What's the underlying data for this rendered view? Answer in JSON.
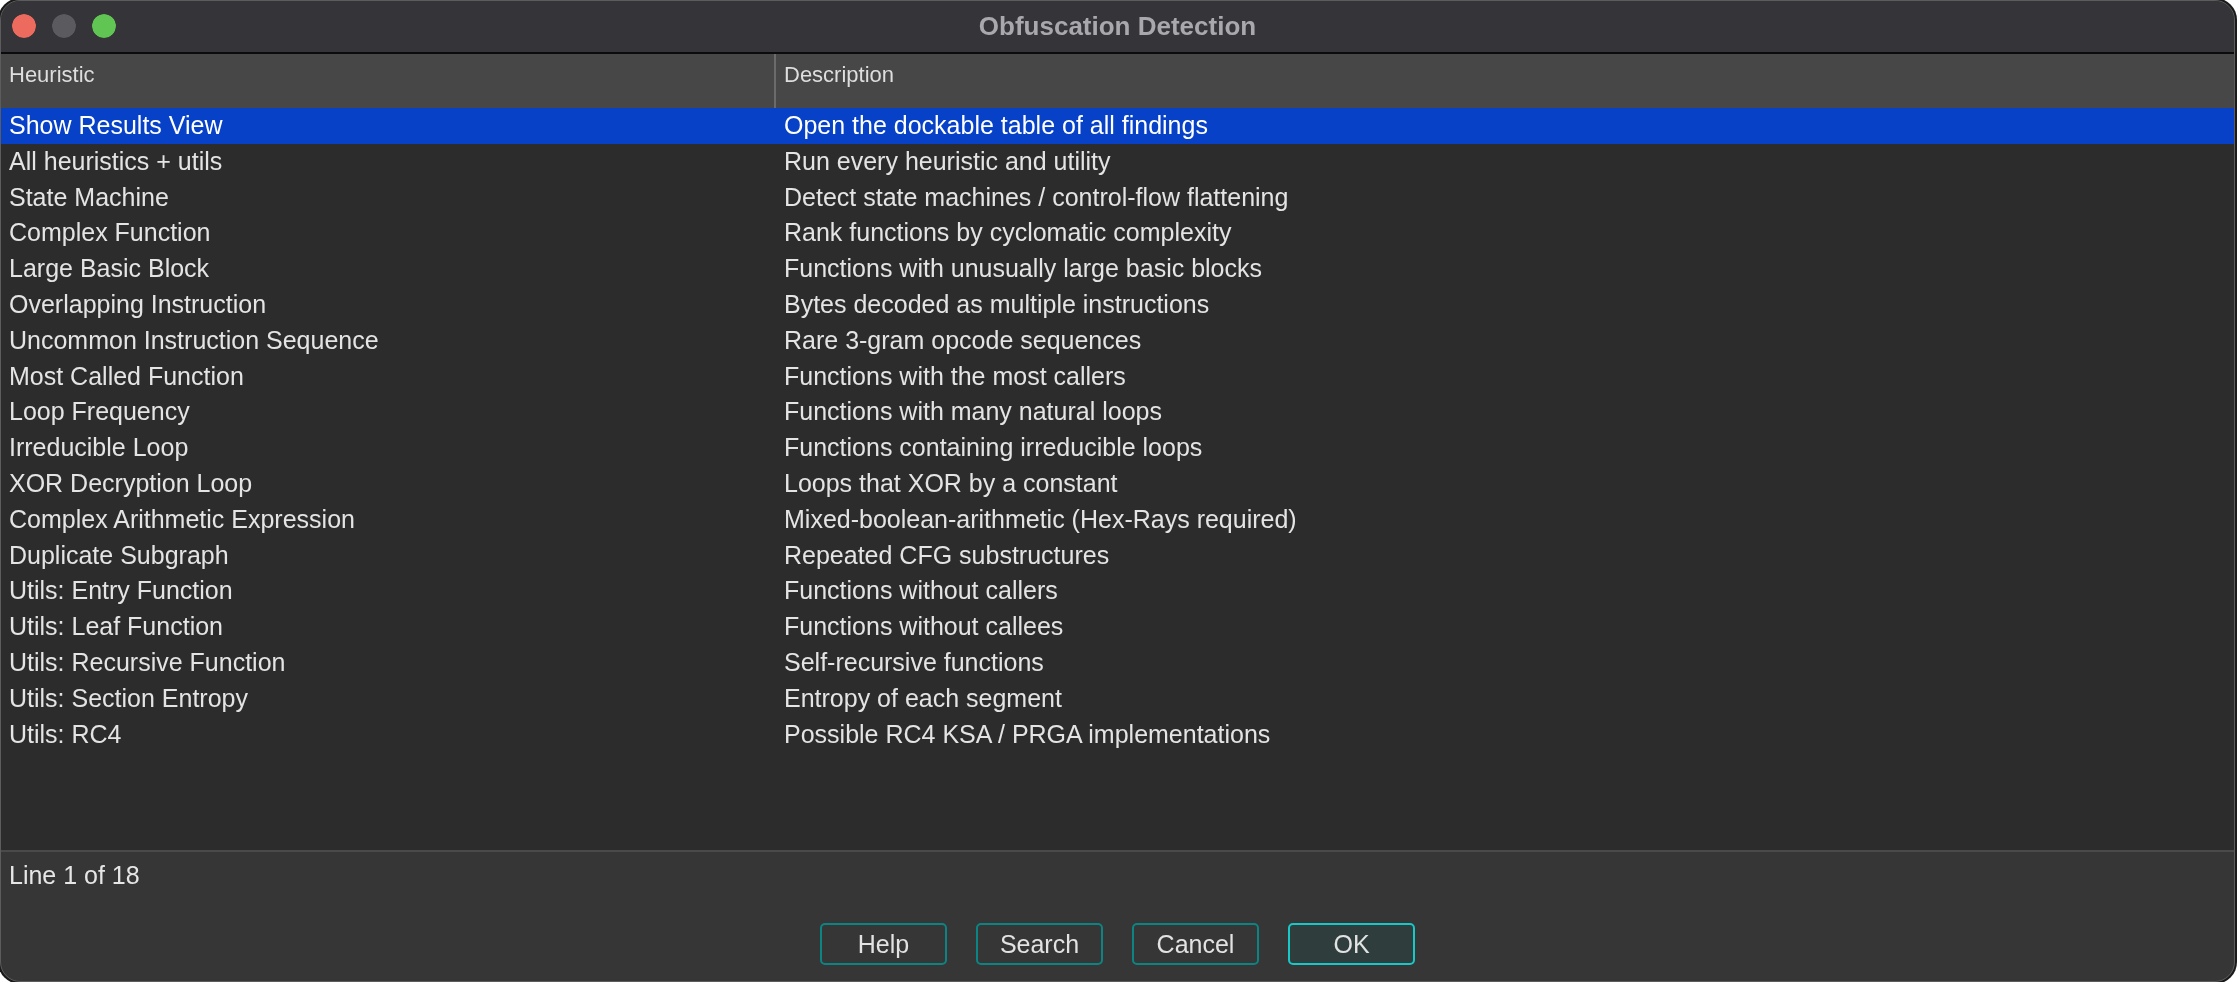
{
  "window": {
    "title": "Obfuscation Detection",
    "controls": [
      {
        "kind": "close",
        "disabled": false
      },
      {
        "kind": "minimize",
        "disabled": true
      },
      {
        "kind": "zoom",
        "disabled": false
      }
    ]
  },
  "table": {
    "columns": [
      "Heuristic",
      "Description"
    ],
    "rows": [
      {
        "heuristic": "Show Results View",
        "description": "Open the dockable table of all findings",
        "selected": true
      },
      {
        "heuristic": "All heuristics + utils",
        "description": "Run every heuristic and utility",
        "selected": false
      },
      {
        "heuristic": "State Machine",
        "description": "Detect state machines / control-flow flattening",
        "selected": false
      },
      {
        "heuristic": "Complex Function",
        "description": "Rank functions by cyclomatic complexity",
        "selected": false
      },
      {
        "heuristic": "Large Basic Block",
        "description": "Functions with unusually large basic blocks",
        "selected": false
      },
      {
        "heuristic": "Overlapping Instruction",
        "description": "Bytes decoded as multiple instructions",
        "selected": false
      },
      {
        "heuristic": "Uncommon Instruction Sequence",
        "description": "Rare 3-gram opcode sequences",
        "selected": false
      },
      {
        "heuristic": "Most Called Function",
        "description": "Functions with the most callers",
        "selected": false
      },
      {
        "heuristic": "Loop Frequency",
        "description": "Functions with many natural loops",
        "selected": false
      },
      {
        "heuristic": "Irreducible Loop",
        "description": "Functions containing irreducible loops",
        "selected": false
      },
      {
        "heuristic": "XOR Decryption Loop",
        "description": "Loops that XOR by a constant",
        "selected": false
      },
      {
        "heuristic": "Complex Arithmetic Expression",
        "description": "Mixed-boolean-arithmetic (Hex-Rays required)",
        "selected": false
      },
      {
        "heuristic": "Duplicate Subgraph",
        "description": "Repeated CFG substructures",
        "selected": false
      },
      {
        "heuristic": "Utils: Entry Function",
        "description": "Functions without callers",
        "selected": false
      },
      {
        "heuristic": "Utils: Leaf Function",
        "description": "Functions without callees",
        "selected": false
      },
      {
        "heuristic": "Utils: Recursive Function",
        "description": "Self-recursive functions",
        "selected": false
      },
      {
        "heuristic": "Utils: Section Entropy",
        "description": "Entropy of each segment",
        "selected": false
      },
      {
        "heuristic": "Utils: RC4",
        "description": "Possible RC4 KSA / PRGA implementations",
        "selected": false
      }
    ]
  },
  "status_bar": {
    "text": "Line 1 of 18"
  },
  "buttons": [
    {
      "label": "Help",
      "default": false
    },
    {
      "label": "Search",
      "default": false
    },
    {
      "label": "Cancel",
      "default": false
    },
    {
      "label": "OK",
      "default": true
    }
  ]
}
